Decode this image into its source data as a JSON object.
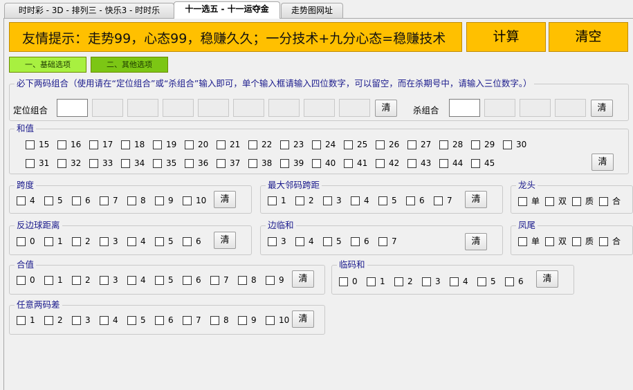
{
  "tabs": [
    {
      "label": "时时彩 - 3D - 排列三 - 快乐3 - 时时乐",
      "active": false
    },
    {
      "label": "十一选五 - 十一运夺金",
      "active": true
    },
    {
      "label": "走势图网址",
      "active": false
    }
  ],
  "banner": {
    "text": "友情提示：走势99，心态99，稳赚久久；一分技术+九分心态=稳赚技术"
  },
  "buttons": {
    "calc": "计算",
    "clear_all": "清空",
    "basic": "一、基础选项",
    "other": "二、其他选项",
    "clear": "清"
  },
  "combo": {
    "title": "必下两码组合（使用请在“定位组合”或“杀组合”输入即可，单个输入框请输入四位数字，可以留空，而在杀期号中，请输入三位数字。）",
    "position_label": "定位组合",
    "kill_label": "杀组合"
  },
  "groups": {
    "sum": {
      "title": "和值",
      "row1": [
        "15",
        "16",
        "17",
        "18",
        "19",
        "20",
        "21",
        "22",
        "23",
        "24",
        "25",
        "26",
        "27",
        "28",
        "29",
        "30"
      ],
      "row2": [
        "31",
        "32",
        "33",
        "34",
        "35",
        "36",
        "37",
        "38",
        "39",
        "40",
        "41",
        "42",
        "43",
        "44",
        "45"
      ]
    },
    "span": {
      "title": "跨度",
      "items": [
        "4",
        "5",
        "6",
        "7",
        "8",
        "9",
        "10"
      ]
    },
    "max_adj_span": {
      "title": "最大邻码跨距",
      "items": [
        "1",
        "2",
        "3",
        "4",
        "5",
        "6",
        "7"
      ]
    },
    "dragon_head": {
      "title": "龙头",
      "items": [
        "单",
        "双",
        "质",
        "合"
      ]
    },
    "edge_dist": {
      "title": "反边球距离",
      "items": [
        "0",
        "1",
        "2",
        "3",
        "4",
        "5",
        "6"
      ]
    },
    "edge_adj_sum": {
      "title": "边临和",
      "items": [
        "3",
        "4",
        "5",
        "6",
        "7"
      ]
    },
    "phoenix_tail": {
      "title": "凤尾",
      "items": [
        "单",
        "双",
        "质",
        "合"
      ]
    },
    "combined": {
      "title": "合值",
      "items": [
        "0",
        "1",
        "2",
        "3",
        "4",
        "5",
        "6",
        "7",
        "8",
        "9"
      ]
    },
    "adj_sum": {
      "title": "临码和",
      "items": [
        "0",
        "1",
        "2",
        "3",
        "4",
        "5",
        "6"
      ]
    },
    "any_diff": {
      "title": "任意两码差",
      "items": [
        "1",
        "2",
        "3",
        "4",
        "5",
        "6",
        "7",
        "8",
        "9",
        "10"
      ]
    }
  }
}
